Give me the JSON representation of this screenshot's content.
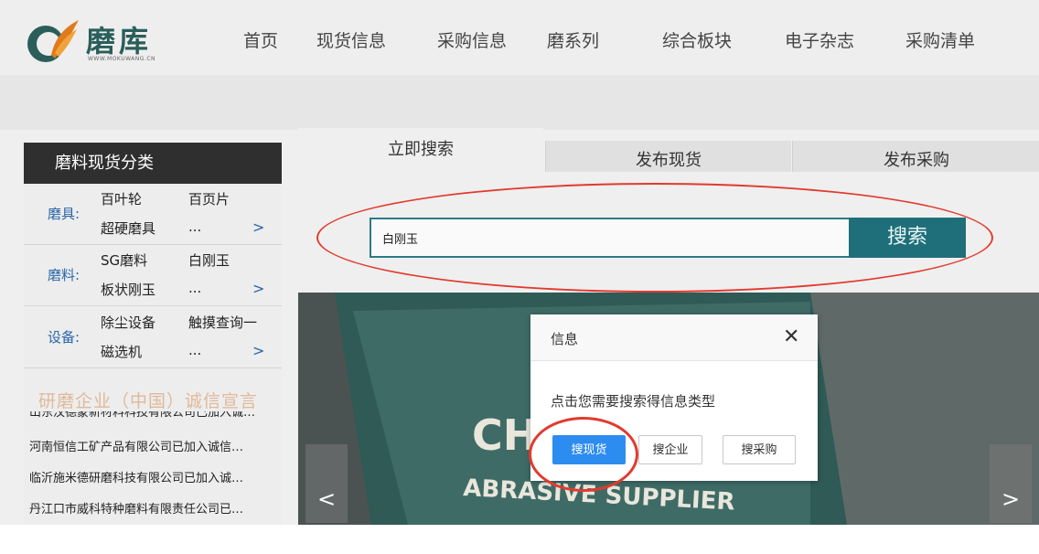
{
  "logo": {
    "text": "磨库",
    "sub": "WWW.MOKUWANG.CN"
  },
  "nav": [
    "首页",
    "现货信息",
    "采购信息",
    "磨系列",
    "综合板块",
    "电子杂志",
    "采购清单"
  ],
  "sidebar": {
    "title": "磨料现货分类",
    "categories": [
      {
        "label": "磨具:",
        "items": [
          "百叶轮",
          "百页片",
          "超硬磨具",
          "..."
        ]
      },
      {
        "label": "磨料:",
        "items": [
          "SG磨料",
          "白刚玉",
          "板状刚玉",
          "..."
        ]
      },
      {
        "label": "设备:",
        "items": [
          "除尘设备",
          "触摸查询一",
          "磁选机",
          "..."
        ]
      }
    ],
    "arrow": ">",
    "slogan": "研磨企业（中国）诚信宣言",
    "news": [
      "山东汉德蒙新材料科技有限公司已加入诚…",
      "河南恒信工矿产品有限公司已加入诚信…",
      "临沂施米德研磨科技有限公司已加入诚…",
      "丹江口市威科特种磨料有限责任公司已…"
    ]
  },
  "tabs": [
    "立即搜索",
    "发布现货",
    "发布采购"
  ],
  "search": {
    "value": "白刚玉",
    "button": "搜索"
  },
  "banner": {
    "line1": "CH",
    "line2": "ABRASIVE SUPPLIER",
    "prev": "<",
    "next": ">"
  },
  "modal": {
    "title": "信息",
    "close": "✕",
    "message": "点击您需要搜索得信息类型",
    "buttons": [
      "搜现货",
      "搜企业",
      "搜采购"
    ]
  },
  "colors": {
    "accent": "#1f6f7a",
    "primary_button": "#2d8cf0",
    "annotation": "#e23a2e"
  }
}
